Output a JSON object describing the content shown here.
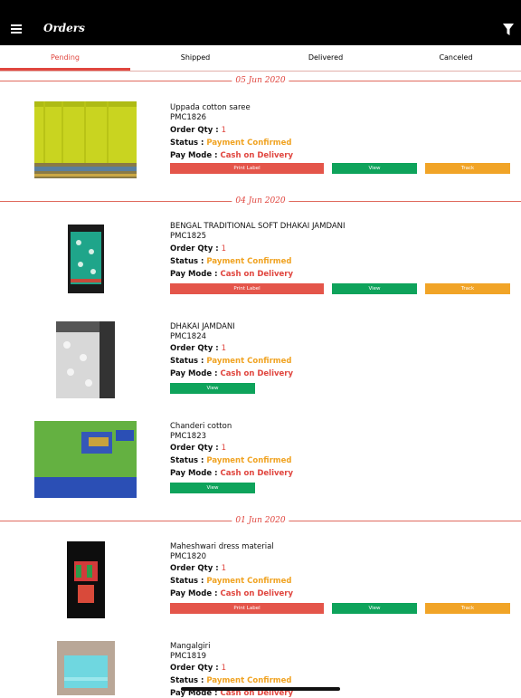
{
  "header": {
    "title": "Orders",
    "menu_icon": "hamburger-menu-icon",
    "filter_icon": "filter-icon"
  },
  "tabs": [
    {
      "label": "Pending",
      "active": true
    },
    {
      "label": "Shipped",
      "active": false
    },
    {
      "label": "Delivered",
      "active": false
    },
    {
      "label": "Canceled",
      "active": false
    }
  ],
  "labels": {
    "order_qty": "Order Qty : ",
    "status": "Status : ",
    "pay_mode": "Pay Mode : ",
    "print_label": "Print Label",
    "view": "View",
    "track": "Track"
  },
  "dates": [
    "05 Jun 2020",
    "04 Jun 2020",
    "01 Jun 2020"
  ],
  "orders": [
    {
      "name": "Uppada cotton saree",
      "code": "PMC1826",
      "qty": "1",
      "status": "Payment Confirmed",
      "pay_mode": "Cash on Delivery"
    },
    {
      "name": "BENGAL TRADITIONAL SOFT DHAKAI JAMDANI",
      "code": "PMC1825",
      "qty": "1",
      "status": "Payment Confirmed",
      "pay_mode": "Cash on Delivery"
    },
    {
      "name": "DHAKAI JAMDANI",
      "code": "PMC1824",
      "qty": "1",
      "status": "Payment Confirmed",
      "pay_mode": "Cash on Delivery"
    },
    {
      "name": "Chanderi cotton",
      "code": "PMC1823",
      "qty": "1",
      "status": "Payment Confirmed",
      "pay_mode": "Cash on Delivery"
    },
    {
      "name": "Maheshwari dress material",
      "code": "PMC1820",
      "qty": "1",
      "status": "Payment Confirmed",
      "pay_mode": "Cash on Delivery"
    },
    {
      "name": "Mangalgiri",
      "code": "PMC1819",
      "qty": "1",
      "status": "Payment Confirmed",
      "pay_mode": "Cash on Delivery"
    }
  ],
  "colors": {
    "accent": "#e0463f",
    "status": "#f0a322",
    "view_button": "#0ea35b",
    "track_button": "#f1a427",
    "print_button": "#e4554a"
  }
}
